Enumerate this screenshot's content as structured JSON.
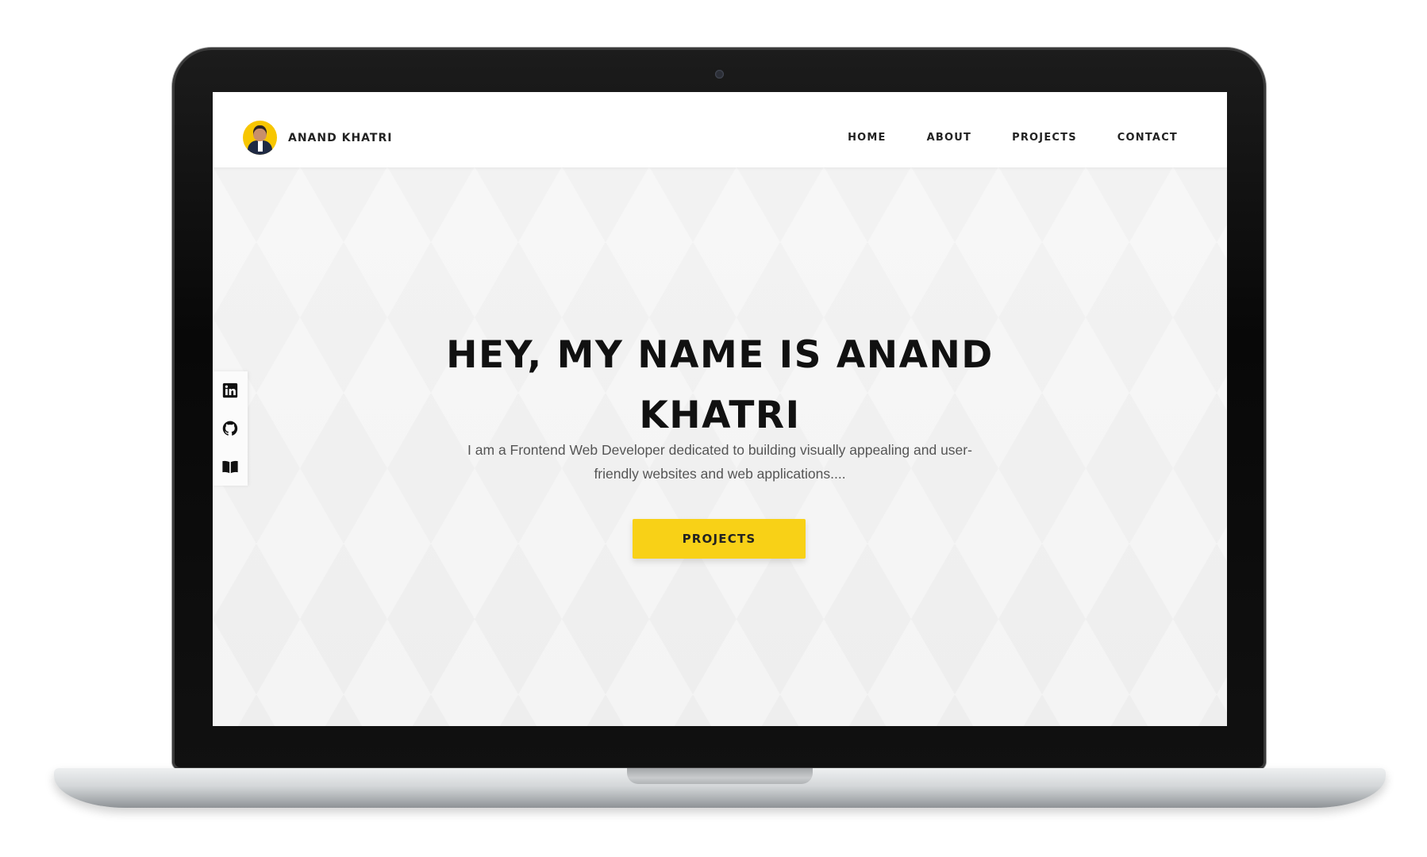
{
  "brand": {
    "name": "ANAND KHATRI"
  },
  "nav": {
    "items": [
      {
        "label": "HOME"
      },
      {
        "label": "ABOUT"
      },
      {
        "label": "PROJECTS"
      },
      {
        "label": "CONTACT"
      }
    ]
  },
  "hero": {
    "title_line1": "HEY, MY NAME IS ANAND",
    "title_line2": "KHATRI",
    "subtitle": "I am a Frontend Web Developer dedicated to building visually appealing and user-friendly websites and web applications....",
    "button_label": "PROJECTS"
  },
  "social": {
    "icons": [
      "linkedin-icon",
      "github-icon",
      "book-icon"
    ]
  },
  "colors": {
    "accent": "#f8d117",
    "text_dark": "#111111",
    "text_muted": "#555555",
    "hero_background": "#f2f2f2"
  }
}
